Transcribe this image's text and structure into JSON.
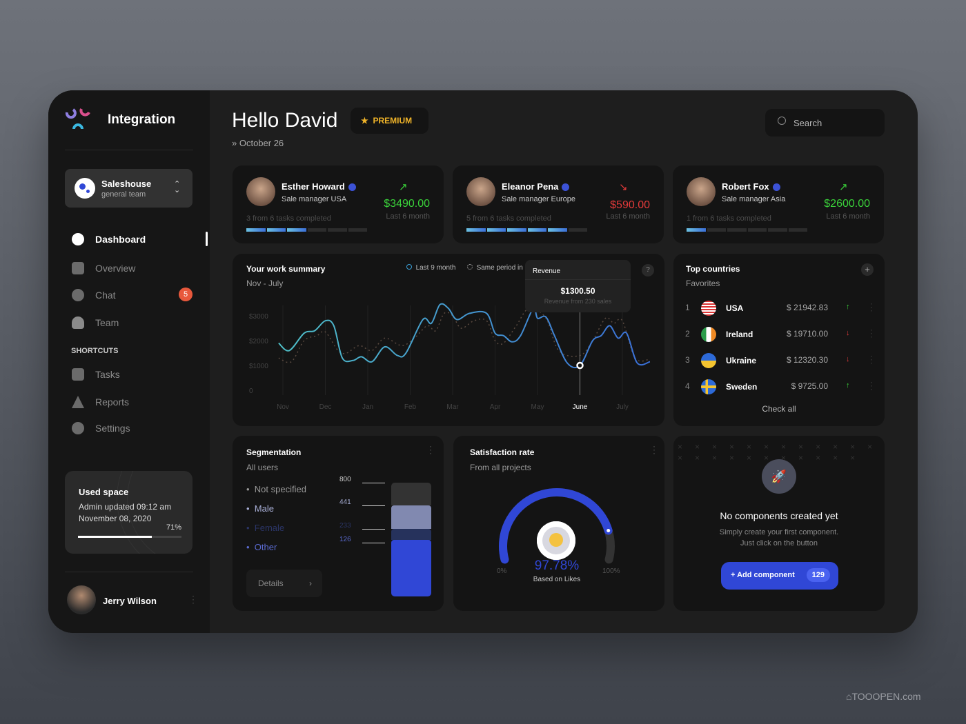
{
  "app": {
    "title": "Integration"
  },
  "team": {
    "name": "Saleshouse",
    "sub": "general team"
  },
  "nav": [
    {
      "label": "Dashboard",
      "icon": "pie-chart-icon",
      "active": true
    },
    {
      "label": "Overview",
      "icon": "bar-chart-icon"
    },
    {
      "label": "Chat",
      "icon": "chat-icon",
      "badge": "5"
    },
    {
      "label": "Team",
      "icon": "user-icon"
    }
  ],
  "shortcuts_label": "SHORTCUTS",
  "shortcuts": [
    {
      "label": "Tasks",
      "icon": "document-icon"
    },
    {
      "label": "Reports",
      "icon": "warning-icon"
    },
    {
      "label": "Settings",
      "icon": "gear-icon"
    }
  ],
  "storage": {
    "title": "Used space",
    "line1": "Admin updated 09:12 am",
    "line2": "November 08, 2020",
    "percent": "71%",
    "value": 71
  },
  "user": {
    "name": "Jerry Wilson"
  },
  "header": {
    "greeting": "Hello David",
    "badge": "PREMIUM",
    "date": "» October 26",
    "search_placeholder": "Search"
  },
  "managers": [
    {
      "name": "Esther Howard",
      "role": "Sale manager USA",
      "tasks": "3 from 6 tasks completed",
      "done": 3,
      "total": 6,
      "amount": "$3490.00",
      "period": "Last 6 month",
      "trend": "up"
    },
    {
      "name": "Eleanor Pena",
      "role": "Sale manager Europe",
      "tasks": "5 from 6 tasks completed",
      "done": 5,
      "total": 6,
      "amount": "$590.00",
      "period": "Last 6 month",
      "trend": "down"
    },
    {
      "name": "Robert Fox",
      "role": "Sale manager Asia",
      "tasks": "1 from 6 tasks completed",
      "done": 1,
      "total": 6,
      "amount": "$2600.00",
      "period": "Last 6 month",
      "trend": "up"
    }
  ],
  "summary": {
    "title": "Your work summary",
    "range": "Nov - July",
    "legend": [
      "Last 9 month",
      "Same period in"
    ],
    "tooltip": {
      "title": "Revenue",
      "value": "$1300.50",
      "sub": "Revenue from 230 sales"
    },
    "help": "?"
  },
  "chart_data": {
    "type": "line",
    "categories": [
      "Nov",
      "Dec",
      "Jan",
      "Feb",
      "Mar",
      "Apr",
      "May",
      "June",
      "July"
    ],
    "highlight": "June",
    "yticks": [
      "0",
      "$1000",
      "$2000",
      "$3000"
    ],
    "ylim": [
      0,
      3600
    ],
    "series": [
      {
        "name": "Last 9 month",
        "color": "#3aa0d8",
        "points": [
          [
            -0.1,
            1900
          ],
          [
            0.15,
            1600
          ],
          [
            0.5,
            2300
          ],
          [
            0.75,
            2400
          ],
          [
            1.0,
            2800
          ],
          [
            1.2,
            2600
          ],
          [
            1.4,
            1300
          ],
          [
            1.65,
            1200
          ],
          [
            1.85,
            1350
          ],
          [
            2.1,
            1150
          ],
          [
            2.4,
            1750
          ],
          [
            2.7,
            1400
          ],
          [
            2.9,
            1500
          ],
          [
            3.3,
            2850
          ],
          [
            3.5,
            2700
          ],
          [
            3.7,
            3450
          ],
          [
            3.9,
            3300
          ],
          [
            4.1,
            2850
          ],
          [
            4.4,
            3100
          ],
          [
            4.8,
            3100
          ],
          [
            5.0,
            2300
          ],
          [
            5.2,
            2200
          ],
          [
            5.4,
            1950
          ],
          [
            5.6,
            2200
          ],
          [
            5.9,
            3300
          ],
          [
            6.0,
            2900
          ],
          [
            6.2,
            2950
          ],
          [
            6.4,
            2200
          ],
          [
            6.7,
            1100
          ],
          [
            7.0,
            1000
          ],
          [
            7.3,
            2000
          ],
          [
            7.5,
            2200
          ],
          [
            7.7,
            2600
          ],
          [
            7.9,
            2100
          ],
          [
            8.1,
            2300
          ],
          [
            8.35,
            1100
          ],
          [
            8.65,
            1150
          ]
        ]
      },
      {
        "name": "Same period in",
        "color": "#5a4a40",
        "points": [
          [
            -0.1,
            1300
          ],
          [
            0.2,
            1150
          ],
          [
            0.5,
            2000
          ],
          [
            0.8,
            2200
          ],
          [
            1.0,
            2350
          ],
          [
            1.3,
            1600
          ],
          [
            1.5,
            1500
          ],
          [
            1.8,
            1800
          ],
          [
            2.1,
            1600
          ],
          [
            2.4,
            2100
          ],
          [
            2.8,
            1800
          ],
          [
            3.1,
            2100
          ],
          [
            3.4,
            2600
          ],
          [
            3.6,
            2400
          ],
          [
            3.8,
            3100
          ],
          [
            4.0,
            3000
          ],
          [
            4.2,
            2500
          ],
          [
            4.5,
            2800
          ],
          [
            4.8,
            2800
          ],
          [
            5.0,
            2000
          ],
          [
            5.2,
            1900
          ],
          [
            5.5,
            2600
          ],
          [
            5.8,
            3300
          ],
          [
            6.2,
            2900
          ],
          [
            6.5,
            1600
          ],
          [
            7.0,
            1400
          ],
          [
            7.3,
            2000
          ],
          [
            7.6,
            2900
          ],
          [
            7.8,
            2700
          ],
          [
            8.0,
            2800
          ],
          [
            8.3,
            1300
          ],
          [
            8.65,
            1250
          ]
        ]
      }
    ]
  },
  "countries": {
    "title": "Top countries",
    "sub": "Favorites",
    "check_all": "Check all",
    "rows": [
      {
        "rank": "1",
        "name": "USA",
        "amount": "$ 21942.83",
        "trend": "up"
      },
      {
        "rank": "2",
        "name": "Ireland",
        "amount": "$ 19710.00",
        "trend": "down"
      },
      {
        "rank": "3",
        "name": "Ukraine",
        "amount": "$ 12320.30",
        "trend": "down"
      },
      {
        "rank": "4",
        "name": "Sweden",
        "amount": "$ 9725.00",
        "trend": "up"
      }
    ]
  },
  "segmentation": {
    "title": "Segmentation",
    "sub": "All users",
    "items": [
      "Not specified",
      "Male",
      "Female",
      "Other"
    ],
    "values": [
      "800",
      "441",
      "233",
      "126"
    ],
    "details": "Details"
  },
  "satisfaction": {
    "title": "Satisfaction rate",
    "sub": "From all projects",
    "value": "97.78%",
    "percent": 97.78,
    "caption": "Based on Likes",
    "min": "0%",
    "max": "100%"
  },
  "components": {
    "title": "No components created yet",
    "line1": "Simply create your first component.",
    "line2": "Just click on the button",
    "button": "+ Add component",
    "count": "129"
  },
  "colors": {
    "accent": "#3047d6",
    "up": "#3ad13a",
    "down": "#e23a3a",
    "badge": "#e8583c",
    "premium": "#f0b429"
  }
}
